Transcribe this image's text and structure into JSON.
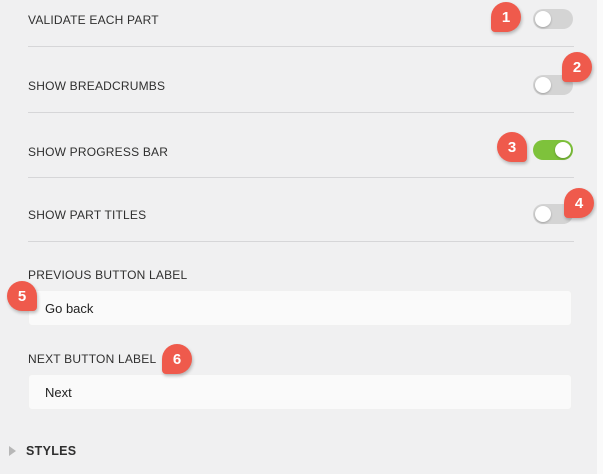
{
  "settings": {
    "validate_each_part": {
      "label": "VALIDATE EACH PART",
      "enabled": false
    },
    "show_breadcrumbs": {
      "label": "SHOW BREADCRUMBS",
      "enabled": false
    },
    "show_progress_bar": {
      "label": "SHOW PROGRESS BAR",
      "enabled": true
    },
    "show_part_titles": {
      "label": "SHOW PART TITLES",
      "enabled": false
    }
  },
  "fields": {
    "previous_button": {
      "label": "PREVIOUS BUTTON LABEL",
      "value": "Go back"
    },
    "next_button": {
      "label": "NEXT BUTTON LABEL",
      "value": "Next"
    }
  },
  "sections": {
    "styles": {
      "label": "STYLES",
      "expanded": false
    }
  },
  "annotations": [
    "1",
    "2",
    "3",
    "4",
    "5",
    "6"
  ],
  "colors": {
    "toggle_on": "#7ec23b",
    "toggle_off": "#d4d4d4",
    "annotation_badge": "#ef5a4c",
    "panel_background": "#f0f0f1"
  }
}
